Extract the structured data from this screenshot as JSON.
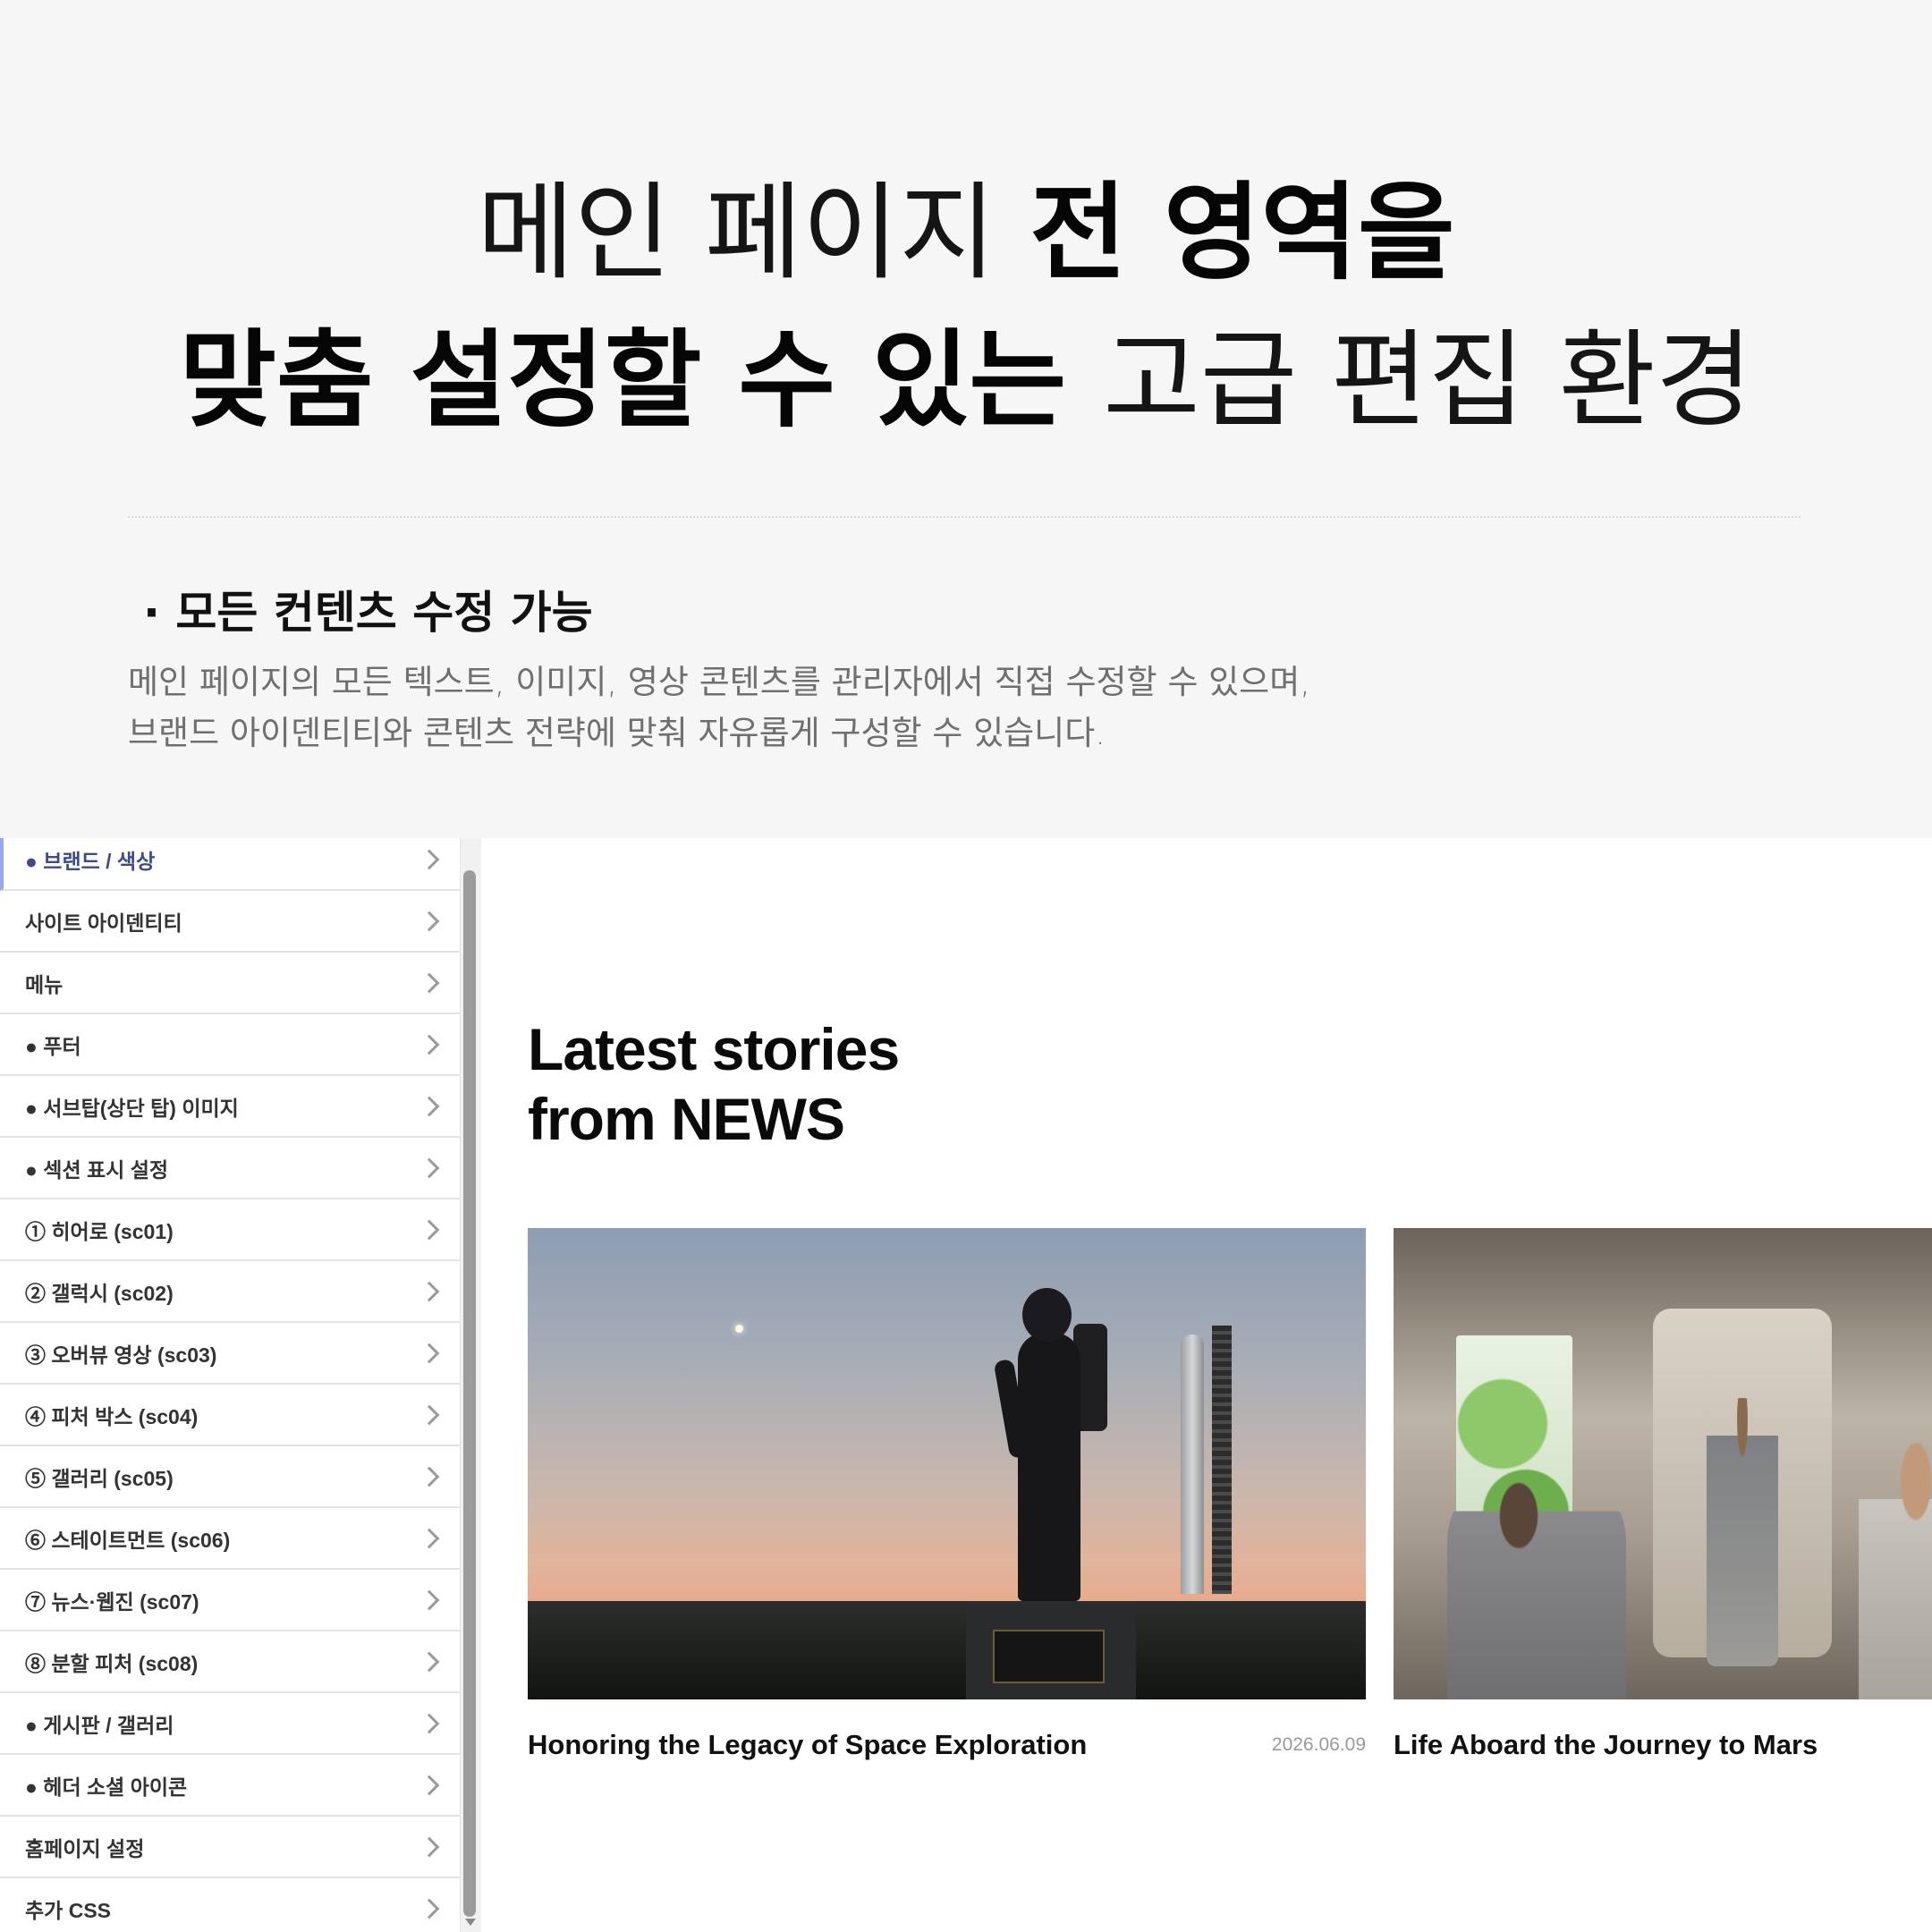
{
  "headline": {
    "line1_thin": "메인 페이지 ",
    "line1_bold": "전 영역을",
    "line2_bold": "맞춤 설정할 수 있는 ",
    "line2_thin": "고급 편집 환경"
  },
  "feature": {
    "title": "· 모든 컨텐츠 수정 가능",
    "desc_line1": "메인 페이지의 모든 텍스트, 이미지, 영상 콘텐츠를 관리자에서 직접 수정할 수 있으며,",
    "desc_line2": "브랜드 아이덴티티와 콘텐츠 전략에 맞춰 자유롭게 구성할 수 있습니다."
  },
  "sidebar": {
    "items": [
      {
        "label": "● 브랜드 / 색상"
      },
      {
        "label": "사이트 아이덴티티"
      },
      {
        "label": "메뉴"
      },
      {
        "label": "● 푸터"
      },
      {
        "label": "● 서브탑(상단 탑) 이미지"
      },
      {
        "label": "● 섹션 표시 설정"
      },
      {
        "label": "① 히어로 (sc01)"
      },
      {
        "label": "② 갤럭시 (sc02)"
      },
      {
        "label": "③ 오버뷰 영상 (sc03)"
      },
      {
        "label": "④ 피처 박스 (sc04)"
      },
      {
        "label": "⑤ 갤러리 (sc05)"
      },
      {
        "label": "⑥ 스테이트먼트 (sc06)"
      },
      {
        "label": "⑦ 뉴스·웹진 (sc07)"
      },
      {
        "label": "⑧ 분할 피처 (sc08)"
      },
      {
        "label": "● 게시판 / 갤러리"
      },
      {
        "label": "● 헤더 소셜 아이콘"
      },
      {
        "label": "홈페이지 설정"
      },
      {
        "label": "추가 CSS"
      }
    ]
  },
  "news": {
    "title_line1": "Latest stories",
    "title_line2": "from NEWS",
    "cards": [
      {
        "title": "Honoring the Legacy of Space Exploration",
        "date": "2026.06.09"
      },
      {
        "title": "Life Aboard the Journey to Mars",
        "date": ""
      }
    ]
  },
  "colors": {
    "background": "#f6f6f6",
    "active_menu": "#3f4a88",
    "active_border": "#9aa8f0"
  }
}
